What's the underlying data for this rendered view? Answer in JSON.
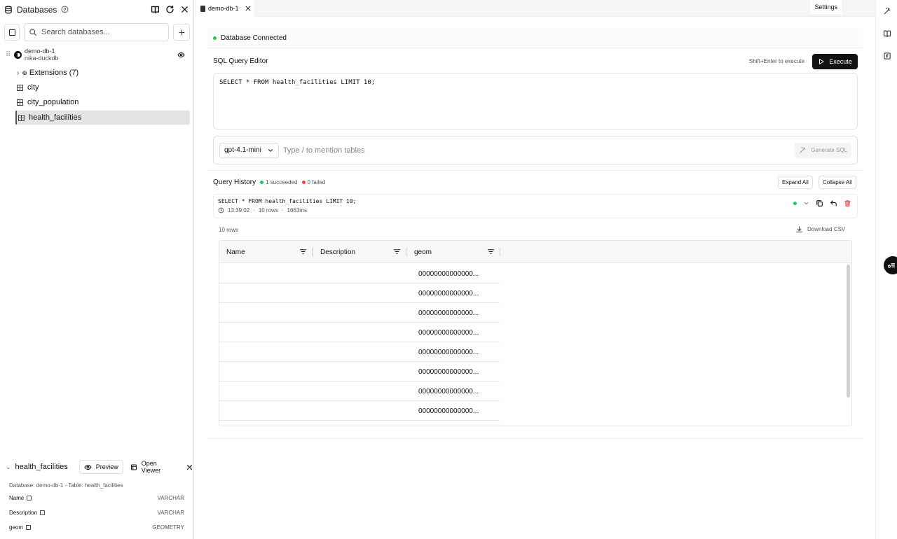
{
  "sidebar": {
    "title": "Databases",
    "search_placeholder": "Search databases...",
    "database": {
      "name": "demo-db-1",
      "subtitle": "nika-duckdb"
    },
    "extensions_label": "Extensions (7)",
    "tables": [
      "city",
      "city_population",
      "health_facilities"
    ],
    "selected_table": "health_facilities",
    "details": {
      "table_name": "health_facilities",
      "preview_label": "Preview",
      "open_viewer_label": "Open Viewer",
      "meta": "Database: demo-db-1 - Table: health_facilities",
      "columns": [
        {
          "name": "Name",
          "type": "VARCHAR"
        },
        {
          "name": "Description",
          "type": "VARCHAR"
        },
        {
          "name": "geom",
          "type": "GEOMETRY"
        }
      ]
    }
  },
  "tabs": {
    "active_label": "demo-db-1",
    "settings_label": "Settings"
  },
  "status": {
    "text": "Database Connected",
    "color": "#22c55e"
  },
  "editor": {
    "title": "SQL Query Editor",
    "hint": "Shift+Enter to execute",
    "execute_label": "Execute",
    "query": "SELECT * FROM health_facilities LIMIT 10;"
  },
  "ai": {
    "model": "gpt-4.1-mini",
    "placeholder": "Type / to mention tables",
    "generate_label": "Generate SQL"
  },
  "history": {
    "title": "Query History",
    "succeeded": "1 succeeded",
    "failed": "0 failed",
    "expand_label": "Expand All",
    "collapse_label": "Collapse All",
    "entry": {
      "query": "SELECT * FROM health_facilities LIMIT 10;",
      "time": "13:39:02",
      "rows": "10 rows",
      "duration": "1663ms"
    }
  },
  "results": {
    "row_count": "10 rows",
    "download_label": "Download CSV",
    "columns": [
      "Name",
      "Description",
      "geom"
    ],
    "rows": [
      {
        "name": "",
        "description": "",
        "geom": "00000000000000..."
      },
      {
        "name": "",
        "description": "",
        "geom": "00000000000000..."
      },
      {
        "name": "",
        "description": "",
        "geom": "00000000000000..."
      },
      {
        "name": "",
        "description": "",
        "geom": "00000000000000..."
      },
      {
        "name": "",
        "description": "",
        "geom": "00000000000000..."
      },
      {
        "name": "",
        "description": "",
        "geom": "00000000000000..."
      },
      {
        "name": "",
        "description": "",
        "geom": "00000000000000..."
      },
      {
        "name": "",
        "description": "",
        "geom": "00000000000000..."
      }
    ]
  },
  "colors": {
    "success": "#22c55e",
    "failure": "#ef4444",
    "delete": "#ef4444",
    "primary_button": "#111111"
  }
}
